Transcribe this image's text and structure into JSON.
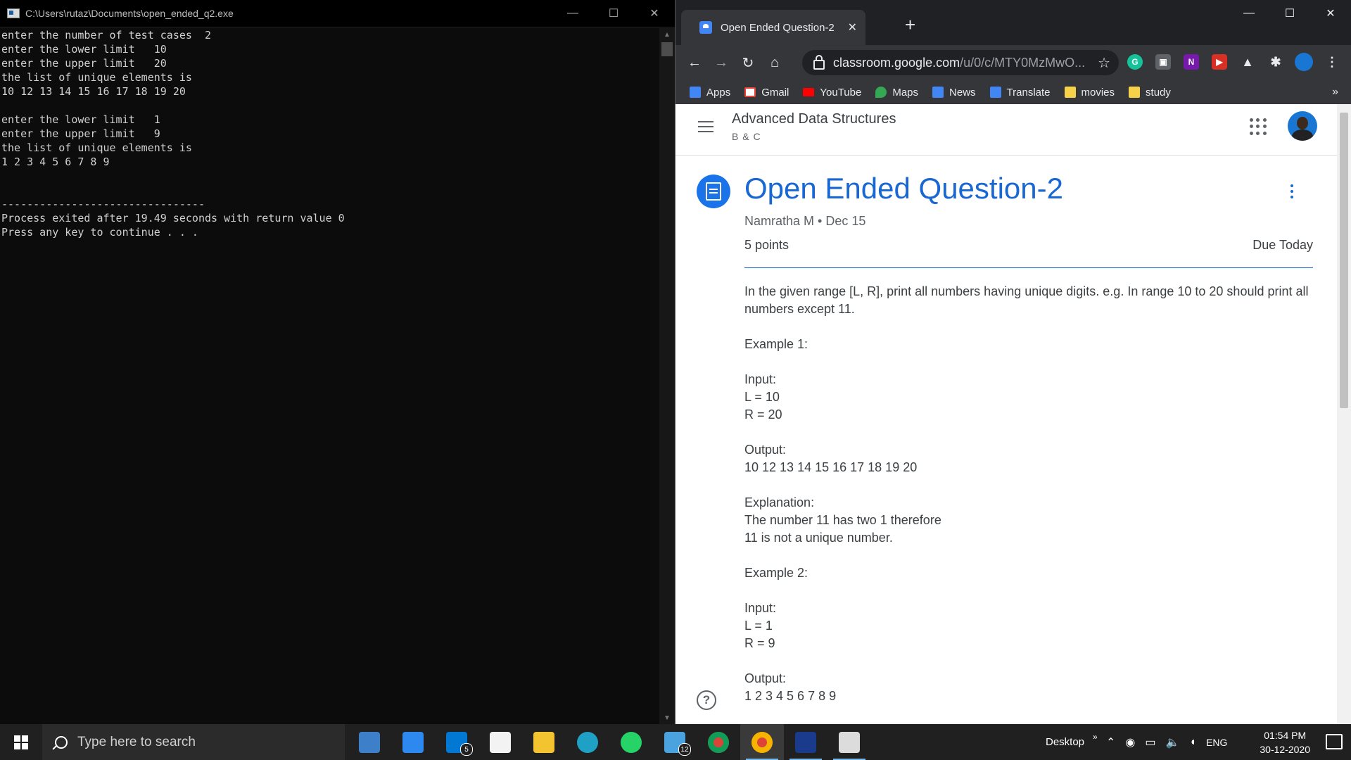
{
  "console": {
    "title": "C:\\Users\\rutaz\\Documents\\open_ended_q2.exe",
    "lines": "enter the number of test cases  2\nenter the lower limit   10\nenter the upper limit   20\nthe list of unique elements is\n10 12 13 14 15 16 17 18 19 20\n\nenter the lower limit   1\nenter the upper limit   9\nthe list of unique elements is\n1 2 3 4 5 6 7 8 9\n\n\n--------------------------------\nProcess exited after 19.49 seconds with return value 0\nPress any key to continue . . ."
  },
  "chrome": {
    "tab_title": "Open Ended Question-2",
    "url_host": "classroom.google.com",
    "url_path": "/u/0/c/MTY0MzMwO...",
    "bookmarks": [
      "Apps",
      "Gmail",
      "YouTube",
      "Maps",
      "News",
      "Translate",
      "movies",
      "study"
    ]
  },
  "classroom": {
    "class_name": "Advanced Data Structures",
    "section": "B & C",
    "assignment_title": "Open Ended Question-2",
    "author": "Namratha M",
    "date": "Dec 15",
    "points": "5 points",
    "due": "Due Today",
    "body": [
      "In the given range [L, R], print all numbers having unique digits. e.g. In range 10 to 20 should print all numbers except 11.",
      "Example 1:",
      "Input:\nL = 10\nR = 20",
      "Output:\n10 12 13 14 15 16 17 18 19 20",
      "Explanation:\nThe number 11 has two 1 therefore\n11 is not a unique number.",
      "Example 2:",
      "Input:\nL = 1\nR = 9",
      "Output:\n1 2 3 4 5 6 7 8 9"
    ]
  },
  "taskbar": {
    "search_placeholder": "Type here to search",
    "mail_badge": "5",
    "files_badge": "12",
    "desktop_label": "Desktop",
    "lang": "ENG",
    "time": "01:54 PM",
    "date": "30-12-2020"
  }
}
